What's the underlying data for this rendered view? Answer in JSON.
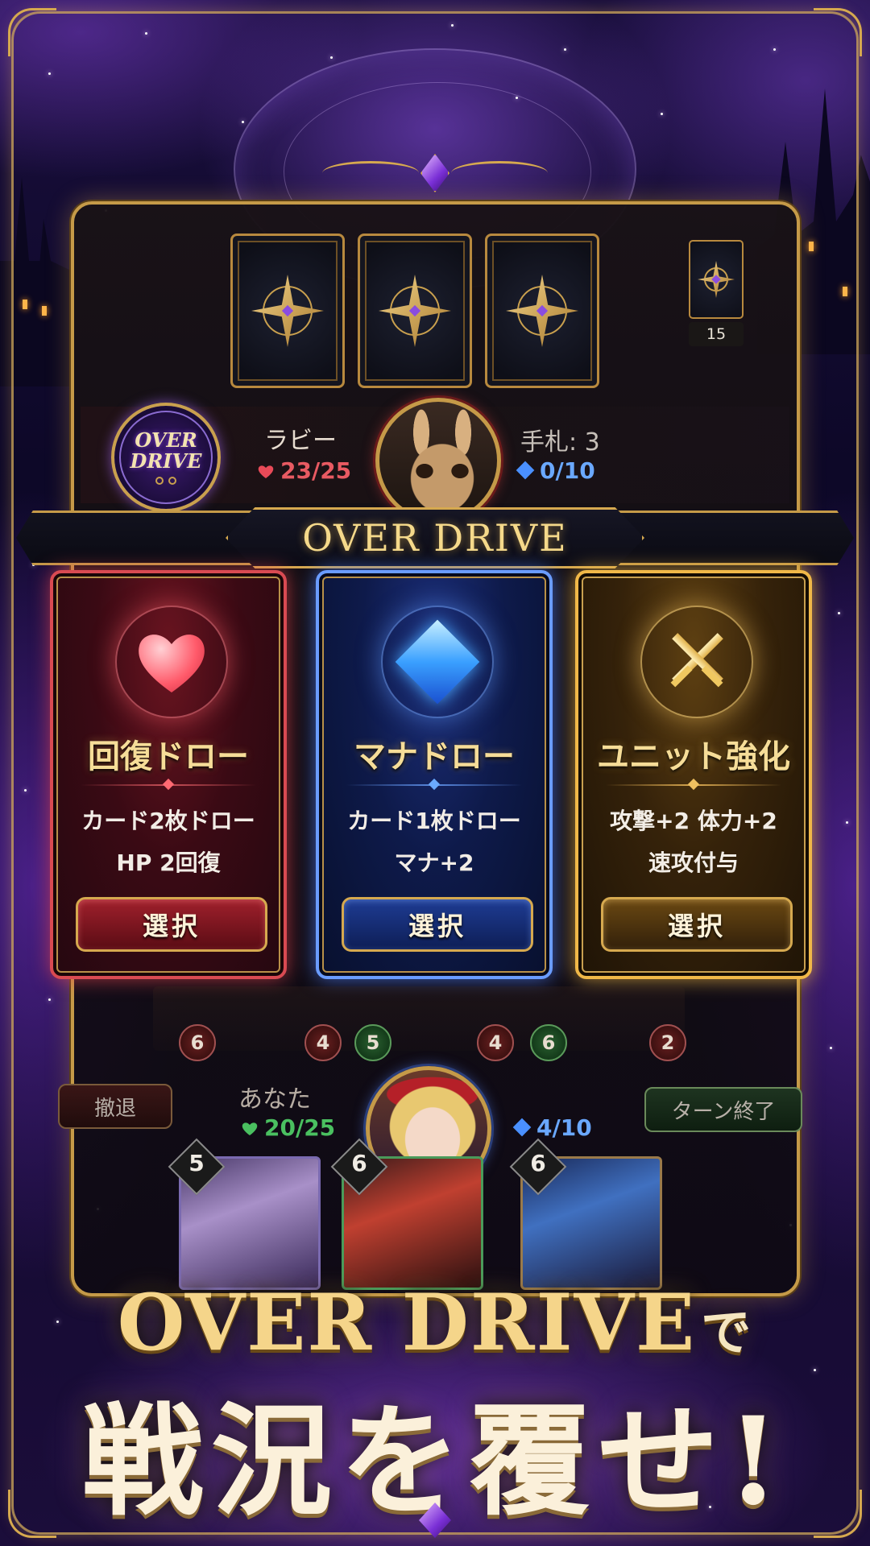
{
  "opponent": {
    "name": "ラビー",
    "hp": "23/25",
    "hand": "手札: 3",
    "mana": "0/10",
    "deck_count": "15",
    "avatar_icon": "rabbit-portrait"
  },
  "overdrive_emblem": {
    "line1": "OVER",
    "line2": "DRIVE"
  },
  "banner": {
    "title": "OVER DRIVE"
  },
  "options": [
    {
      "id": "heal",
      "title": "回復ドロー",
      "line1": "カード2枚ドロー",
      "line2": "HP 2回復",
      "button": "選択",
      "icon": "heart-icon",
      "color": "#d94a52"
    },
    {
      "id": "mana",
      "title": "マナドロー",
      "line1": "カード1枚ドロー",
      "line2": "マナ+2",
      "button": "選択",
      "icon": "diamond-icon",
      "color": "#6a9cff"
    },
    {
      "id": "unit",
      "title": "ユニット強化",
      "line1": "攻撃+2 体力+2",
      "line2": "速攻付与",
      "button": "選択",
      "icon": "crossed-swords-icon",
      "color": "#f0b848"
    }
  ],
  "field_stats": [
    "6",
    "4",
    "5",
    "4",
    "6",
    "2"
  ],
  "player": {
    "name": "あなた",
    "hp": "20/25",
    "mana": "4/10",
    "avatar_icon": "girl-portrait"
  },
  "buttons": {
    "retreat": "撤退",
    "end_turn": "ターン終了"
  },
  "hand_cards": [
    {
      "cost": "5"
    },
    {
      "cost": "6"
    },
    {
      "cost": "6"
    }
  ],
  "headline": {
    "line1": "OVER DRIVE",
    "line1_suffix": "で",
    "line2": "戦況を覆せ!"
  },
  "colors": {
    "accent_gold": "#d6a94f",
    "heart_red": "#e84a58",
    "heart_green": "#4ac060",
    "mana_blue": "#4a90ff"
  }
}
